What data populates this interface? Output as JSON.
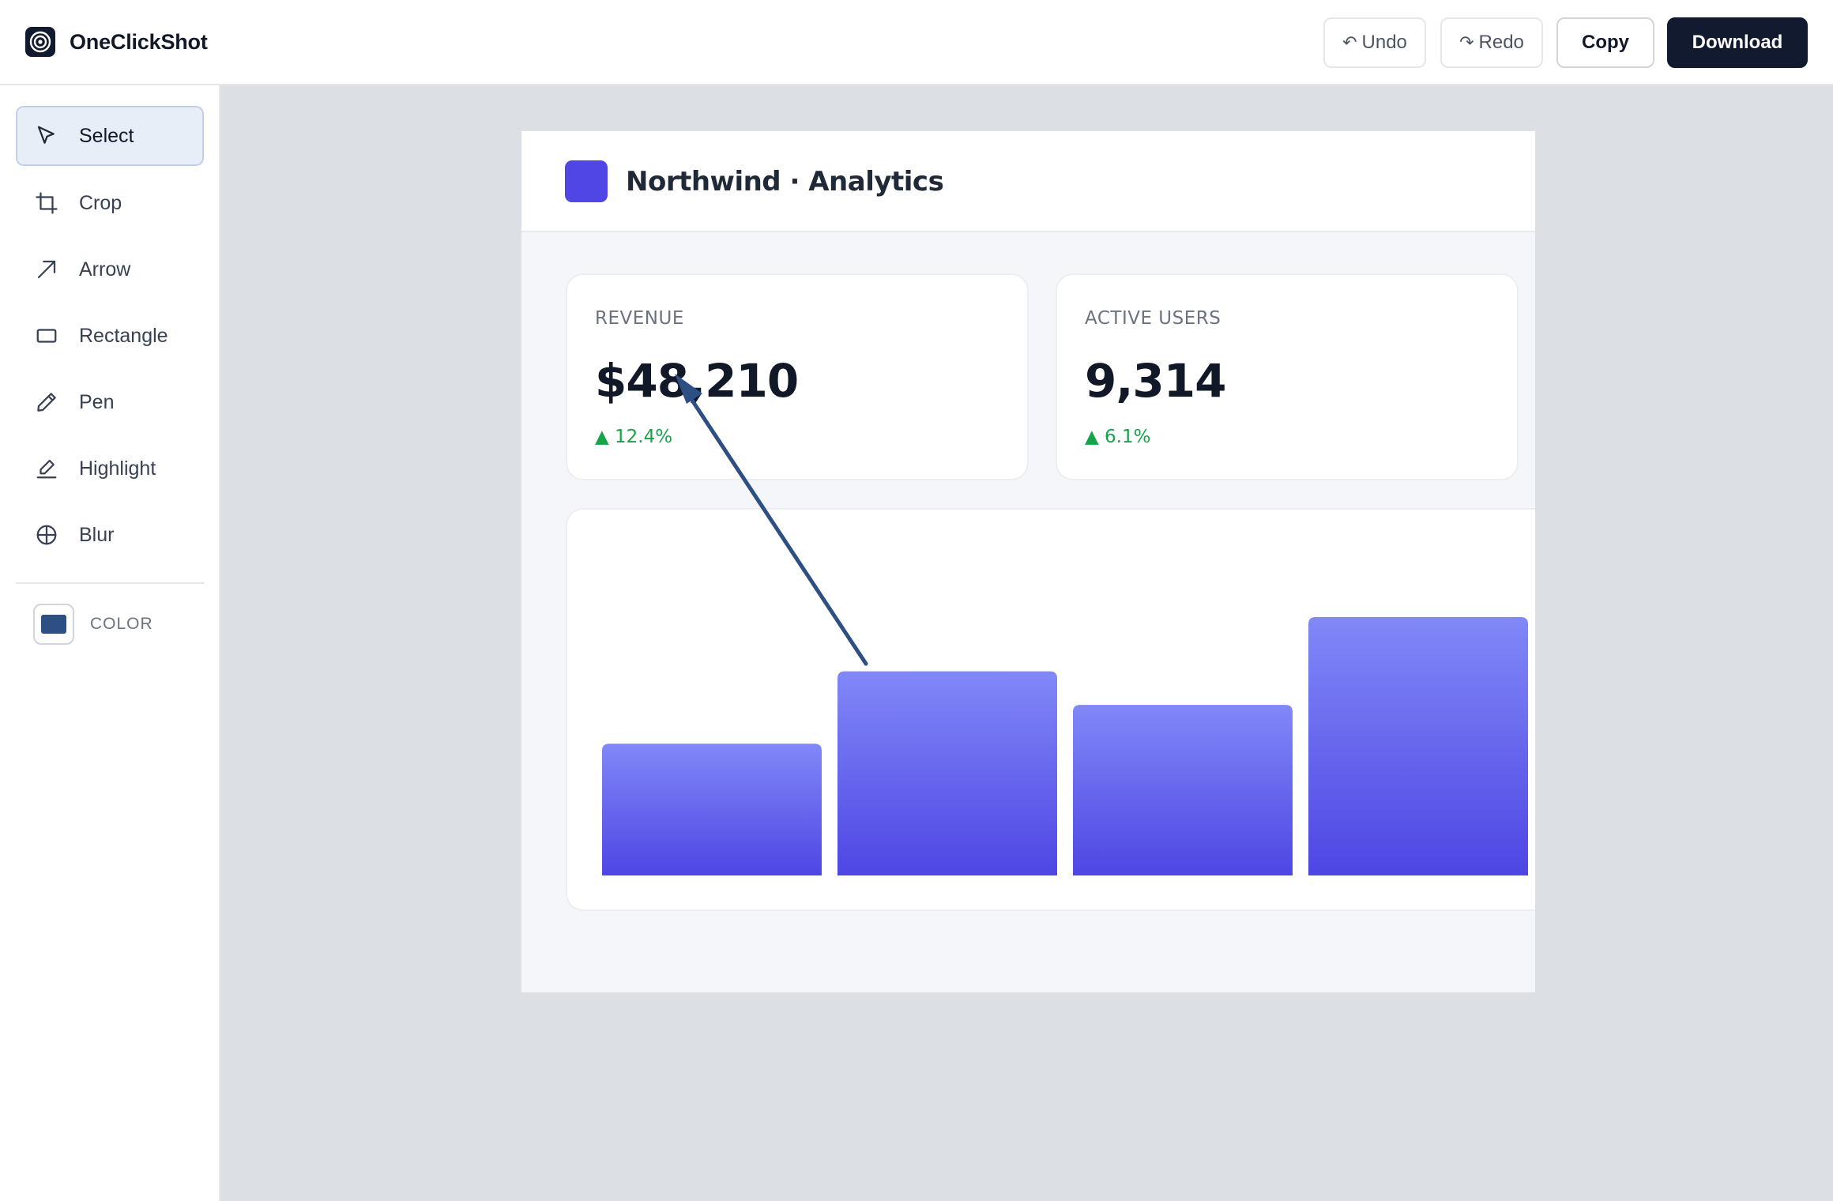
{
  "app": {
    "name": "OneClickShot",
    "icon": "aperture-icon"
  },
  "toolbar": {
    "undo": {
      "glyph": "↶",
      "label": "Undo"
    },
    "redo": {
      "glyph": "↷",
      "label": "Redo"
    },
    "copy": "Copy",
    "download": "Download"
  },
  "sidebar": {
    "tools": [
      {
        "label": "Select",
        "icon": "cursor-icon",
        "active": true
      },
      {
        "label": "Crop",
        "icon": "crop-icon",
        "active": false
      },
      {
        "label": "Arrow",
        "icon": "arrow-icon",
        "active": false
      },
      {
        "label": "Rectangle",
        "icon": "rectangle-icon",
        "active": false
      },
      {
        "label": "Pen",
        "icon": "pen-icon",
        "active": false
      },
      {
        "label": "Highlight",
        "icon": "highlighter-icon",
        "active": false
      },
      {
        "label": "Blur",
        "icon": "blur-icon",
        "active": false
      }
    ],
    "color": {
      "label": "COLOR",
      "value": "#2e4f84"
    }
  },
  "screenshot": {
    "title": "Northwind · Analytics",
    "logo_color": "#4f46e5",
    "kpis": [
      {
        "label": "REVENUE",
        "value": "$48,210",
        "delta": "▲ 12.4%"
      },
      {
        "label": "ACTIVE USERS",
        "value": "9,314",
        "delta": "▲ 6.1%"
      }
    ],
    "chart": {
      "type": "bar",
      "relative_values": [
        0.51,
        0.79,
        0.66,
        1.0
      ],
      "gradient_top": "#8188f7",
      "gradient_bottom": "#4e46e4"
    }
  },
  "annotation": {
    "type": "arrow",
    "color": "#2e4f84"
  },
  "colors": {
    "canvas_bg": "#dcdfe4",
    "primary_dark": "#111a2e",
    "positive": "#16a34a"
  }
}
